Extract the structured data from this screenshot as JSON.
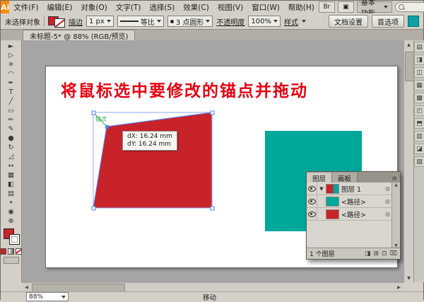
{
  "app": {
    "logo": "Ai",
    "workspace": "基本功能"
  },
  "menu": {
    "items": [
      "文件(F)",
      "编辑(E)",
      "对象(O)",
      "文字(T)",
      "选择(S)",
      "效果(C)",
      "视图(V)",
      "窗口(W)",
      "帮助(H)"
    ]
  },
  "appbar": {
    "bridge": "Br",
    "arrange": "▣"
  },
  "control": {
    "no_selection": "未选择对象",
    "stroke_label": "描边",
    "stroke_width": "1 px",
    "profile": "等比",
    "brush": "3 点圆形",
    "opacity_label": "不透明度",
    "opacity_value": "100%",
    "style_label": "样式",
    "doc_setup": "文档设置",
    "preferences": "首选项"
  },
  "tab": {
    "title": "未标题-5* @ 88% (RGB/预览)"
  },
  "artboard": {
    "heading": "将鼠标选中要修改的锚点并拖动"
  },
  "guides": {
    "anchor_label": "锚点",
    "dx": "dX: 16.24 mm",
    "dy": "dY: 16.24 mm"
  },
  "colors": {
    "red": "#c9232a",
    "teal": "#00a79b",
    "blue": "#4f7fff",
    "lightblue": "#8fa7ff",
    "green": "#35a845",
    "heading": "#e60012"
  },
  "tools": {
    "glyphs": [
      "►",
      "▷",
      "✳",
      "◠",
      "✒",
      "T",
      "╱",
      "▭",
      "✏",
      "✎",
      "●",
      "↻",
      "◿",
      "↔",
      "▦",
      "◧",
      "▤",
      "⌖",
      "◉",
      "⊕"
    ]
  },
  "layers": {
    "tabs": [
      "图层",
      "画板"
    ],
    "menu_icon": "≡",
    "layer1": "图层 1",
    "path_label": "<路径>",
    "count": "1 个图层",
    "footer_icons": [
      "◨",
      "⊞",
      "⊡",
      "⌧"
    ]
  },
  "icons": {
    "triangle": "▼",
    "target": "◎",
    "up": "▲",
    "down": "▼",
    "left": "◀",
    "right": "▶"
  },
  "dock": {
    "glyphs": [
      "▤",
      "◨",
      "◫",
      "▦",
      "▩",
      "◰",
      "⬒",
      "▥",
      "◪",
      "▧"
    ]
  },
  "status": {
    "zoom": "88%",
    "tool": "移动"
  }
}
